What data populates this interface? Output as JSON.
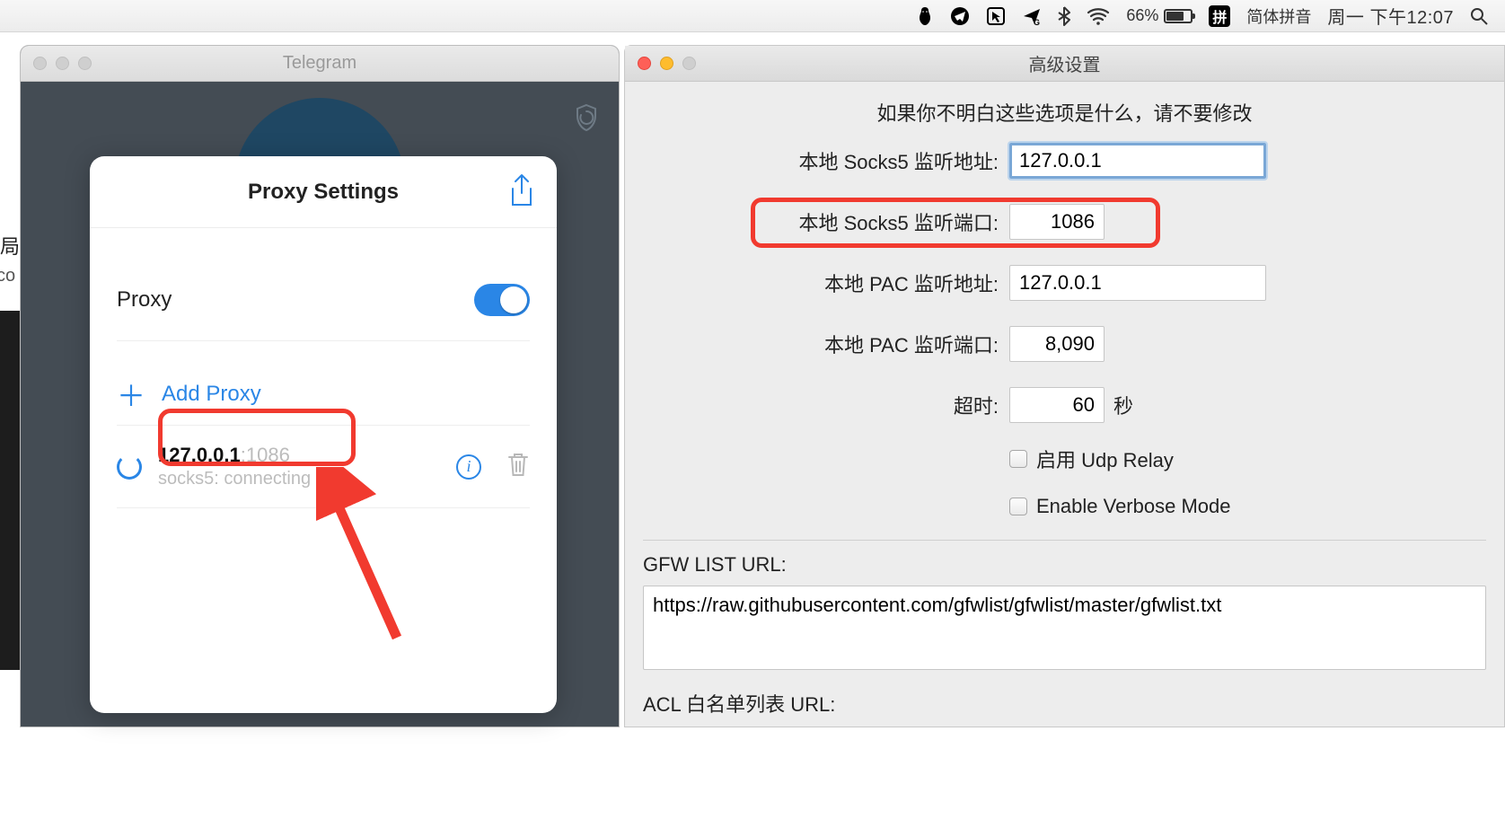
{
  "menubar": {
    "battery_pct": "66%",
    "ime_box": "拼",
    "ime_label": "简体拼音",
    "clock": "周一 下午12:07"
  },
  "bg_left": {
    "line1": "局",
    "line2": "co"
  },
  "telegram": {
    "title": "Telegram",
    "popup": {
      "title": "Proxy Settings",
      "proxy_label": "Proxy",
      "add_proxy_label": "Add Proxy",
      "entry": {
        "ip": "127.0.0.1",
        "port_sep": ":",
        "port": "1086",
        "status": "socks5: connecting"
      }
    }
  },
  "settings": {
    "title": "高级设置",
    "warning": "如果你不明白这些选项是什么，请不要修改",
    "socks5_addr_label": "本地 Socks5 监听地址:",
    "socks5_addr_value": "127.0.0.1",
    "socks5_port_label": "本地 Socks5 监听端口:",
    "socks5_port_value": "1086",
    "pac_addr_label": "本地 PAC 监听地址:",
    "pac_addr_value": "127.0.0.1",
    "pac_port_label": "本地 PAC 监听端口:",
    "pac_port_value": "8,090",
    "timeout_label": "超时:",
    "timeout_value": "60",
    "timeout_suffix": "秒",
    "udp_relay_label": "启用 Udp Relay",
    "verbose_label": "Enable Verbose Mode",
    "gfw_label": "GFW LIST URL:",
    "gfw_value": "https://raw.githubusercontent.com/gfwlist/gfwlist/master/gfwlist.txt",
    "acl_label": "ACL 白名单列表 URL:"
  }
}
